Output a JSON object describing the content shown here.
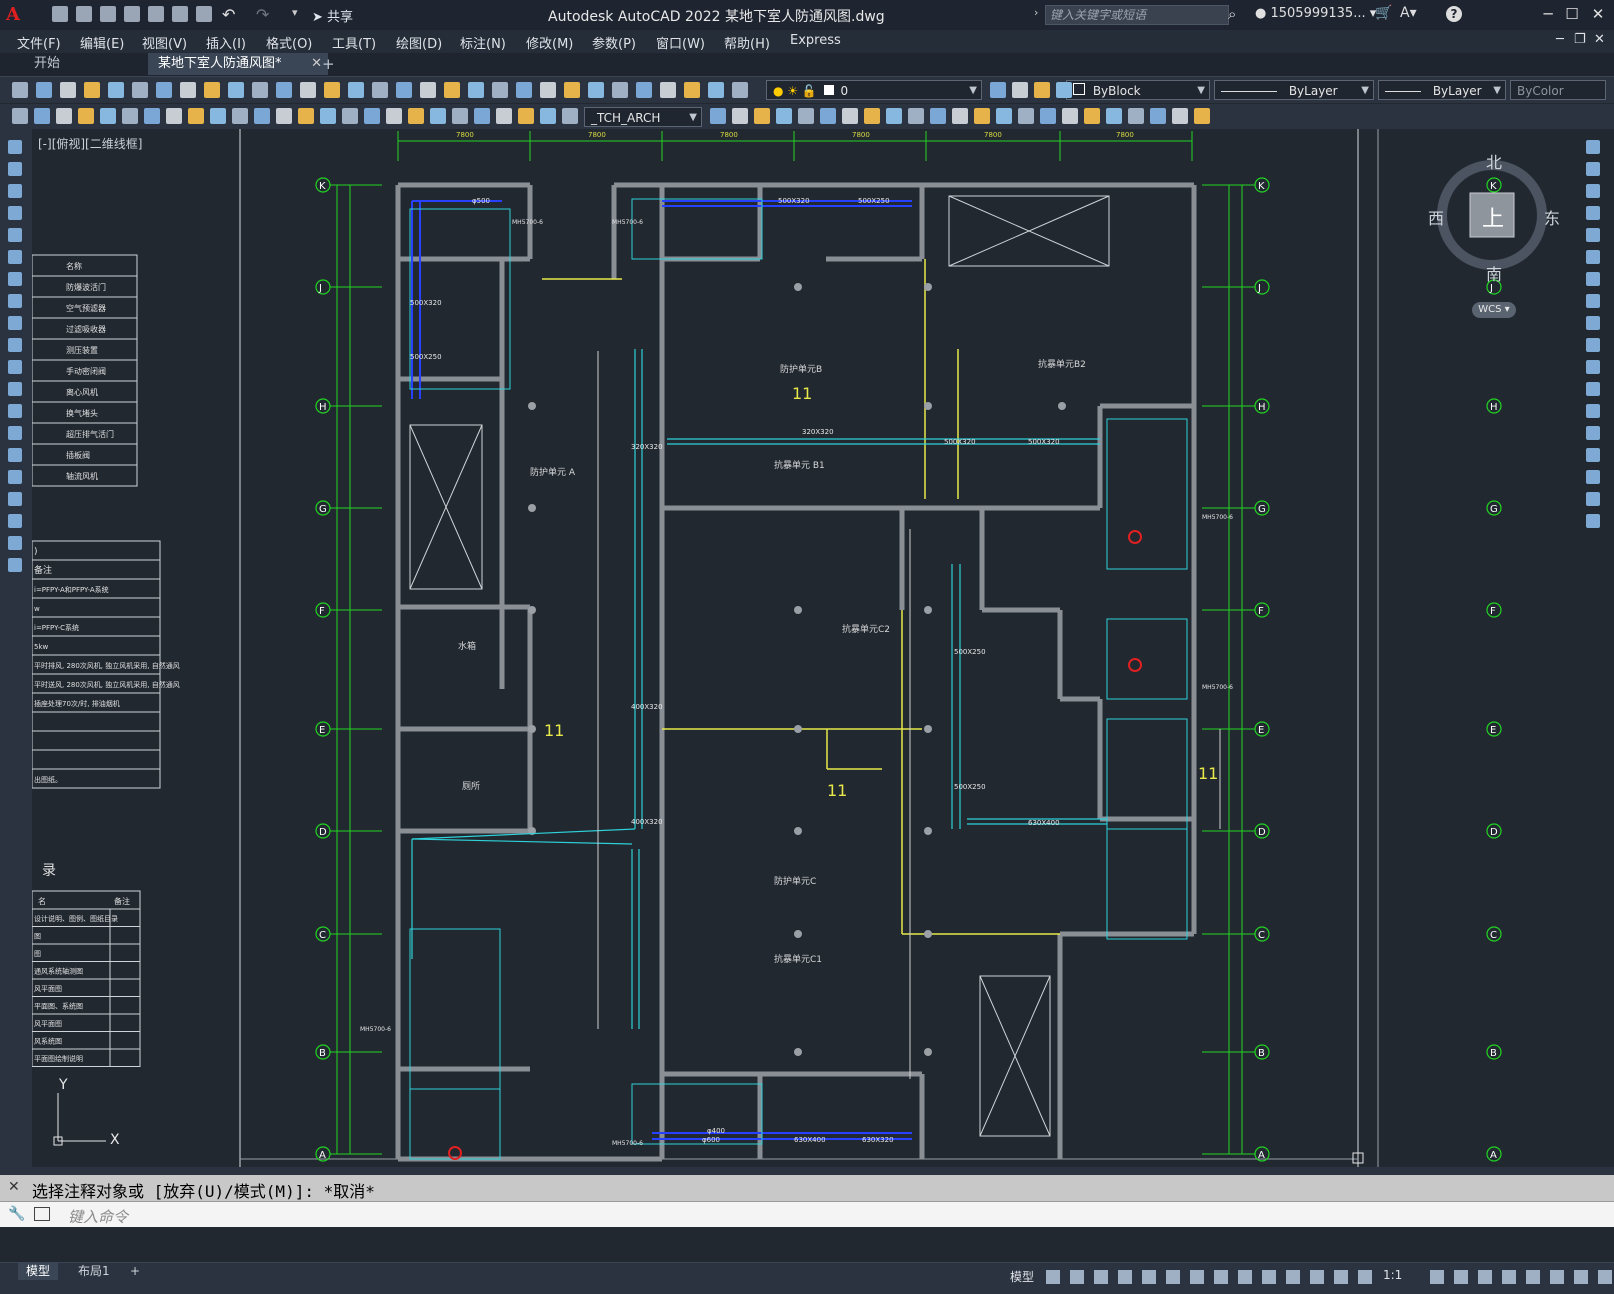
{
  "app": {
    "logo_letter": "A",
    "share_label": "共享",
    "title": "Autodesk AutoCAD 2022    某地下室人防通风图.dwg",
    "search_placeholder": "键入关键字或短语",
    "user": "1505999135...",
    "help": "?"
  },
  "menu": [
    "文件(F)",
    "编辑(E)",
    "视图(V)",
    "插入(I)",
    "格式(O)",
    "工具(T)",
    "绘图(D)",
    "标注(N)",
    "修改(M)",
    "参数(P)",
    "窗口(W)",
    "帮助(H)",
    "Express"
  ],
  "tabs": [
    {
      "label": "开始",
      "active": false
    },
    {
      "label": "某地下室人防通风图*",
      "active": true
    }
  ],
  "toolbars": {
    "layer_value": "0",
    "color_value": "ByBlock",
    "linetype_value": "ByLayer",
    "lineweight_value": "ByLayer",
    "plotstyle_value": "ByColor",
    "textstyle_value": "_TCH_ARCH"
  },
  "viewport_label": "[-][俯视][二维线框]",
  "compass": {
    "north": "北",
    "south": "南",
    "east": "东",
    "west": "西",
    "top": "上",
    "wcs": "WCS"
  },
  "command": {
    "history": "选择注释对象或 [放弃(U)/模式(M)]: *取消*",
    "placeholder": "键入命令"
  },
  "layout_tabs": [
    "模型",
    "布局1"
  ],
  "status": {
    "model_label": "模型",
    "scale": "1:1"
  },
  "drawing": {
    "grid_rows": [
      "K",
      "J",
      "H",
      "G",
      "F",
      "E",
      "D",
      "C",
      "B",
      "A"
    ],
    "top_dims": [
      "7800",
      "7800",
      "7800",
      "7800",
      "7800",
      "7800"
    ],
    "legend_rows": [
      "名称",
      "防爆波活门",
      "空气预滤器",
      "过滤吸收器",
      "测压装置",
      "手动密闭阀",
      "离心风机",
      "换气堵头",
      "超压排气活门",
      "插板阀",
      "轴流风机"
    ],
    "notes_rows": [
      ")",
      "备注",
      "i=PFPY-A和PFPY-A系统",
      "w",
      "i=PFPY-C系统",
      "5kw",
      "平时排风, 280次风机, 独立风机采用, 自然通风",
      "平时送风, 280次风机, 独立风机采用, 自然通风",
      "插座处理70次/时, 排油烟机",
      "",
      "",
      "",
      "出图纸。"
    ],
    "index_title": "录",
    "index_head": [
      "名",
      "备注"
    ],
    "index_rows": [
      "设计说明、图例、图纸目录",
      "图",
      "图",
      "通风系统轴测图",
      "风平面图",
      "平面图、系统图",
      "风平面图",
      "风系统图",
      "平面图绘制说明"
    ],
    "room_labels": [
      {
        "text": "防护单元B"
      },
      {
        "text": "抗暴单元B2"
      },
      {
        "text": "抗暴单元 B1"
      },
      {
        "text": "防护单元 A"
      },
      {
        "text": "抗暴单元C2"
      },
      {
        "text": "防护单元C"
      },
      {
        "text": "抗暴单元C1"
      },
      {
        "text": "水箱"
      },
      {
        "text": "厕所"
      }
    ],
    "duct_labels": [
      "φ500",
      "500X320",
      "500X250",
      "500X320",
      "500X250",
      "320X320",
      "500X320",
      "500X320",
      "500X250",
      "500X250",
      "630X400",
      "φ600",
      "630X400",
      "630X320",
      "400X320",
      "400X320",
      "320X320",
      "φ400"
    ],
    "equip_labels": [
      "MH5700-6",
      "MH5700-6",
      "MH5700-6",
      "MH5700-6",
      "MH5700-6",
      "MH5700-6"
    ],
    "marks": [
      "11",
      "11",
      "11",
      "11"
    ]
  }
}
